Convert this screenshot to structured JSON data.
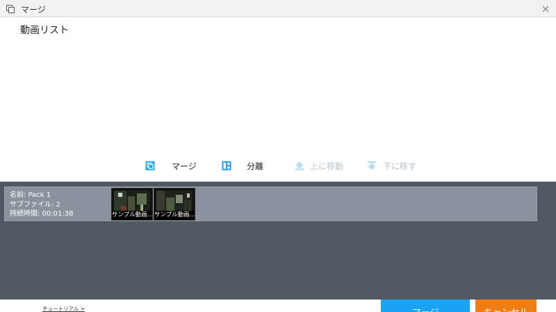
{
  "window": {
    "title": "マージ",
    "icons": {
      "app": "merge-window-icon",
      "close": "close-icon"
    }
  },
  "video_list": {
    "heading": "動画リスト"
  },
  "toolbar": {
    "merge_label": "マージ",
    "split_label": "分離",
    "move_up_label": "上に移動",
    "move_down_label": "下に移す",
    "icons": {
      "merge": "merge-icon",
      "split": "split-icon",
      "move_up": "arrow-up-icon",
      "move_down": "arrow-down-icon"
    },
    "disabled": [
      "move_up",
      "move_down"
    ]
  },
  "pack": {
    "name_line": "名前: Pack 1",
    "subfile_line": "サブファイル: 2",
    "duration_line": "持続時間: 00:01:38",
    "clips": [
      {
        "caption": "サンプル動画…"
      },
      {
        "caption": "サンプル動画…"
      }
    ]
  },
  "footer": {
    "tutorial_link": "チュートリアル >",
    "merge_button": "マージ",
    "cancel_button": "キャンセル"
  },
  "colors": {
    "accent_blue": "#1aa3f5",
    "cancel_orange": "#f07c14",
    "panel_dark": "#525861",
    "pack_row": "#8a939d",
    "disabled_text": "#b9c3cc"
  }
}
